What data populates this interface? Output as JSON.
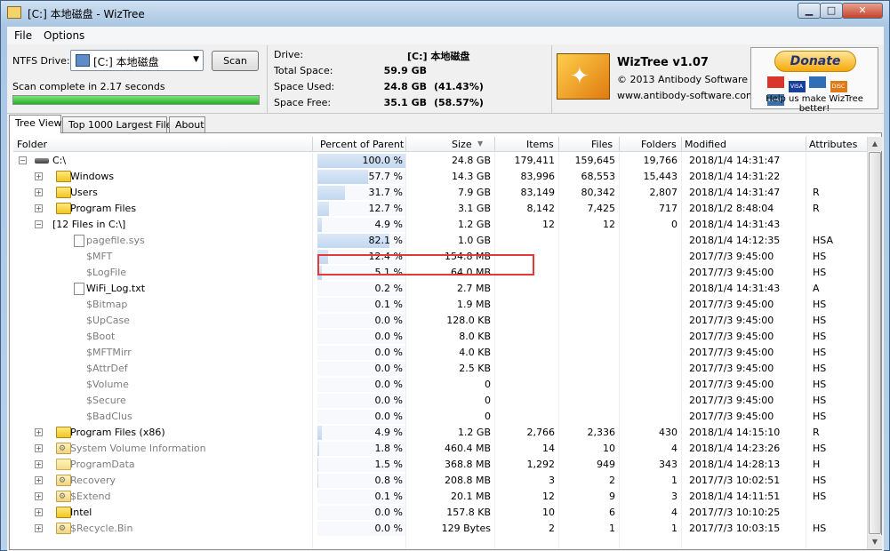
{
  "window": {
    "title": "[C:] 本地磁盘  - WizTree",
    "min": "▁",
    "max": "□",
    "close": "✕"
  },
  "menu": {
    "file": "File",
    "options": "Options"
  },
  "toolbar": {
    "ntfs_label": "NTFS Drive:",
    "drive_selected": "[C:] 本地磁盘",
    "scan_label": "Scan",
    "status": "Scan complete in 2.17 seconds",
    "progress": 1.0
  },
  "info": {
    "drive_label": "Drive:",
    "drive_value": "[C:]  本地磁盘",
    "total_label": "Total Space:",
    "total_value": "59.9 GB",
    "used_label": "Space Used:",
    "used_value": "24.8 GB",
    "used_pct": "(41.43%)",
    "free_label": "Space Free:",
    "free_value": "35.1 GB",
    "free_pct": "(58.57%)"
  },
  "about": {
    "name": "WizTree v1.07",
    "copyright": "© 2013 Antibody Software",
    "website": "www.antibody-software.com"
  },
  "donate": {
    "button": "Donate",
    "cards": [
      "VISA",
      "DISC",
      "BANK"
    ],
    "caption": "Help us make WizTree better!"
  },
  "tabs": [
    {
      "label": "Tree View"
    },
    {
      "label": "Top 1000 Largest Files"
    },
    {
      "label": "About"
    }
  ],
  "columns": {
    "folder": "Folder",
    "percent": "Percent of Parent",
    "size": "Size",
    "items": "Items",
    "files": "Files",
    "folders": "Folders",
    "modified": "Modified",
    "attributes": "Attributes"
  },
  "rows": [
    {
      "name": "C:\\",
      "icon": "drive",
      "level": 0,
      "exp": "−",
      "pct": "100.0 %",
      "pv": 100,
      "size": "24.8 GB",
      "items": "179,411",
      "files": "159,645",
      "folders": "19,766",
      "mod": "2018/1/4 14:31:47",
      "attr": "",
      "gray": false
    },
    {
      "name": "Windows",
      "icon": "folder",
      "level": 1,
      "exp": "+",
      "pct": "57.7 %",
      "pv": 57.7,
      "size": "14.3 GB",
      "items": "83,996",
      "files": "68,553",
      "folders": "15,443",
      "mod": "2018/1/4 14:31:22",
      "attr": "",
      "gray": false
    },
    {
      "name": "Users",
      "icon": "folder",
      "level": 1,
      "exp": "+",
      "pct": "31.7 %",
      "pv": 31.7,
      "size": "7.9 GB",
      "items": "83,149",
      "files": "80,342",
      "folders": "2,807",
      "mod": "2018/1/4 14:31:47",
      "attr": "R",
      "gray": false
    },
    {
      "name": "Program Files",
      "icon": "folder",
      "level": 1,
      "exp": "+",
      "pct": "12.7 %",
      "pv": 12.7,
      "size": "3.1 GB",
      "items": "8,142",
      "files": "7,425",
      "folders": "717",
      "mod": "2018/1/2 8:48:04",
      "attr": "R",
      "gray": false
    },
    {
      "name": "[12 Files in C:\\]",
      "icon": "",
      "level": 1,
      "exp": "−",
      "pct": "4.9 %",
      "pv": 4.9,
      "size": "1.2 GB",
      "items": "12",
      "files": "12",
      "folders": "0",
      "mod": "2018/1/4 14:31:43",
      "attr": "",
      "gray": false
    },
    {
      "name": "pagefile.sys",
      "icon": "file",
      "level": 2,
      "exp": "",
      "pct": "82.1 %",
      "pv": 82.1,
      "size": "1.0 GB",
      "items": "",
      "files": "",
      "folders": "",
      "mod": "2018/1/4 14:12:35",
      "attr": "HSA",
      "gray": true
    },
    {
      "name": "$MFT",
      "icon": "",
      "level": 2,
      "exp": "",
      "pct": "12.4 %",
      "pv": 12.4,
      "size": "154.8 MB",
      "items": "",
      "files": "",
      "folders": "",
      "mod": "2017/7/3 9:45:00",
      "attr": "HS",
      "gray": true
    },
    {
      "name": "$LogFile",
      "icon": "",
      "level": 2,
      "exp": "",
      "pct": "5.1 %",
      "pv": 5.1,
      "size": "64.0 MB",
      "items": "",
      "files": "",
      "folders": "",
      "mod": "2017/7/3 9:45:00",
      "attr": "HS",
      "gray": true
    },
    {
      "name": "WiFi_Log.txt",
      "icon": "file",
      "level": 2,
      "exp": "",
      "pct": "0.2 %",
      "pv": 0.2,
      "size": "2.7 MB",
      "items": "",
      "files": "",
      "folders": "",
      "mod": "2018/1/4 14:31:43",
      "attr": "A",
      "gray": false
    },
    {
      "name": "$Bitmap",
      "icon": "",
      "level": 2,
      "exp": "",
      "pct": "0.1 %",
      "pv": 0.1,
      "size": "1.9 MB",
      "items": "",
      "files": "",
      "folders": "",
      "mod": "2017/7/3 9:45:00",
      "attr": "HS",
      "gray": true
    },
    {
      "name": "$UpCase",
      "icon": "",
      "level": 2,
      "exp": "",
      "pct": "0.0 %",
      "pv": 0,
      "size": "128.0 KB",
      "items": "",
      "files": "",
      "folders": "",
      "mod": "2017/7/3 9:45:00",
      "attr": "HS",
      "gray": true
    },
    {
      "name": "$Boot",
      "icon": "",
      "level": 2,
      "exp": "",
      "pct": "0.0 %",
      "pv": 0,
      "size": "8.0 KB",
      "items": "",
      "files": "",
      "folders": "",
      "mod": "2017/7/3 9:45:00",
      "attr": "HS",
      "gray": true
    },
    {
      "name": "$MFTMirr",
      "icon": "",
      "level": 2,
      "exp": "",
      "pct": "0.0 %",
      "pv": 0,
      "size": "4.0 KB",
      "items": "",
      "files": "",
      "folders": "",
      "mod": "2017/7/3 9:45:00",
      "attr": "HS",
      "gray": true
    },
    {
      "name": "$AttrDef",
      "icon": "",
      "level": 2,
      "exp": "",
      "pct": "0.0 %",
      "pv": 0,
      "size": "2.5 KB",
      "items": "",
      "files": "",
      "folders": "",
      "mod": "2017/7/3 9:45:00",
      "attr": "HS",
      "gray": true
    },
    {
      "name": "$Volume",
      "icon": "",
      "level": 2,
      "exp": "",
      "pct": "0.0 %",
      "pv": 0,
      "size": "0",
      "items": "",
      "files": "",
      "folders": "",
      "mod": "2017/7/3 9:45:00",
      "attr": "HS",
      "gray": true
    },
    {
      "name": "$Secure",
      "icon": "",
      "level": 2,
      "exp": "",
      "pct": "0.0 %",
      "pv": 0,
      "size": "0",
      "items": "",
      "files": "",
      "folders": "",
      "mod": "2017/7/3 9:45:00",
      "attr": "HS",
      "gray": true
    },
    {
      "name": "$BadClus",
      "icon": "",
      "level": 2,
      "exp": "",
      "pct": "0.0 %",
      "pv": 0,
      "size": "0",
      "items": "",
      "files": "",
      "folders": "",
      "mod": "2017/7/3 9:45:00",
      "attr": "HS",
      "gray": true
    },
    {
      "name": "Program Files (x86)",
      "icon": "folder",
      "level": 1,
      "exp": "+",
      "pct": "4.9 %",
      "pv": 4.9,
      "size": "1.2 GB",
      "items": "2,766",
      "files": "2,336",
      "folders": "430",
      "mod": "2018/1/4 14:15:10",
      "attr": "R",
      "gray": false
    },
    {
      "name": "System Volume Information",
      "icon": "sysfolder",
      "level": 1,
      "exp": "+",
      "pct": "1.8 %",
      "pv": 1.8,
      "size": "460.4 MB",
      "items": "14",
      "files": "10",
      "folders": "4",
      "mod": "2018/1/4 14:23:26",
      "attr": "HS",
      "gray": true
    },
    {
      "name": "ProgramData",
      "icon": "lightfolder",
      "level": 1,
      "exp": "+",
      "pct": "1.5 %",
      "pv": 1.5,
      "size": "368.8 MB",
      "items": "1,292",
      "files": "949",
      "folders": "343",
      "mod": "2018/1/4 14:28:13",
      "attr": "H",
      "gray": true
    },
    {
      "name": "Recovery",
      "icon": "sysfolder",
      "level": 1,
      "exp": "+",
      "pct": "0.8 %",
      "pv": 0.8,
      "size": "208.8 MB",
      "items": "3",
      "files": "2",
      "folders": "1",
      "mod": "2017/7/3 10:02:51",
      "attr": "HS",
      "gray": true
    },
    {
      "name": "$Extend",
      "icon": "sysfolder",
      "level": 1,
      "exp": "+",
      "pct": "0.1 %",
      "pv": 0.1,
      "size": "20.1 MB",
      "items": "12",
      "files": "9",
      "folders": "3",
      "mod": "2018/1/4 14:11:51",
      "attr": "HS",
      "gray": true
    },
    {
      "name": "Intel",
      "icon": "folder",
      "level": 1,
      "exp": "+",
      "pct": "0.0 %",
      "pv": 0,
      "size": "157.8 KB",
      "items": "10",
      "files": "6",
      "folders": "4",
      "mod": "2017/7/3 10:10:25",
      "attr": "",
      "gray": false
    },
    {
      "name": "$Recycle.Bin",
      "icon": "sysfolder",
      "level": 1,
      "exp": "+",
      "pct": "0.0 %",
      "pv": 0,
      "size": "129 Bytes",
      "items": "2",
      "files": "1",
      "folders": "1",
      "mod": "2017/7/3 10:03:15",
      "attr": "HS",
      "gray": true
    }
  ],
  "colors": {
    "highlight": "#e03a3a",
    "bar": "#c2d8f0",
    "progress": "#22b322"
  }
}
